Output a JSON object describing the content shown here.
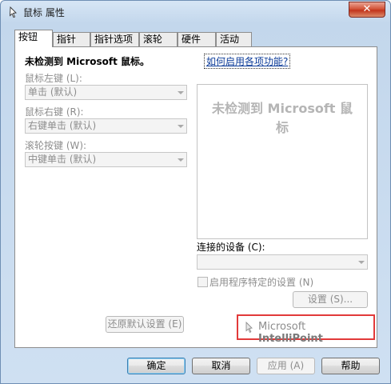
{
  "window": {
    "title": "鼠标 属性",
    "close_label": "✕"
  },
  "tabs": [
    "按钮",
    "指针",
    "指针选项",
    "滚轮",
    "硬件",
    "活动"
  ],
  "panel": {
    "no_mouse_message": "未检测到 Microsoft 鼠标。",
    "help_link": "如何启用各项功能?",
    "left_button": {
      "label": "鼠标左键 (L):",
      "value": "单击 (默认)"
    },
    "right_button": {
      "label": "鼠标右键 (R):",
      "value": "右键单击 (默认)"
    },
    "wheel_button": {
      "label": "滚轮按键 (W):",
      "value": "中键单击 (默认)"
    },
    "preview_text": "未检测到 Microsoft 鼠标",
    "connected_device_label": "连接的设备 (C):",
    "app_specific_label": "启用程序特定的设置 (N)",
    "settings_button": "设置 (S)...",
    "restore_defaults_button": "还原默认设置 (E)",
    "brand": {
      "prefix": "Microsoft ",
      "product": "IntelliPoint"
    }
  },
  "footer": {
    "ok": "确定",
    "cancel": "取消",
    "apply": "应用 (A)",
    "help": "帮助"
  }
}
